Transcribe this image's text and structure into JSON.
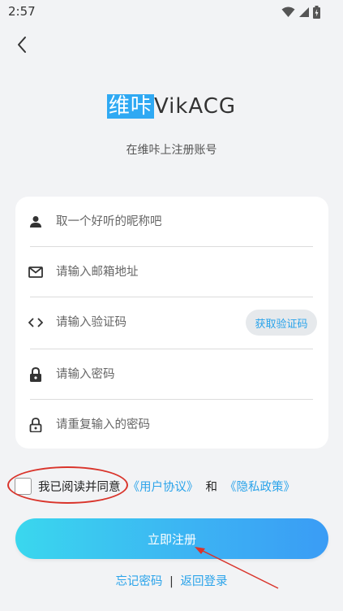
{
  "status_bar": {
    "time": "2:57"
  },
  "header": {
    "back_icon": "chevron-left-icon"
  },
  "brand": {
    "logo_cn": "维咔",
    "logo_en": "VikACG",
    "subtitle": "在维咔上注册账号"
  },
  "form": {
    "nickname": {
      "placeholder": "取一个好听的昵称吧",
      "value": "",
      "icon": "person-icon"
    },
    "email": {
      "placeholder": "请输入邮箱地址",
      "value": "",
      "icon": "mail-icon"
    },
    "code": {
      "placeholder": "请输入验证码",
      "value": "",
      "icon": "code-icon"
    },
    "get_code_label": "获取验证码",
    "password": {
      "placeholder": "请输入密码",
      "value": "",
      "icon": "lock-icon"
    },
    "password_confirm": {
      "placeholder": "请重复输入的密码",
      "value": "",
      "icon": "lock-outline-icon"
    }
  },
  "agreement": {
    "checked": false,
    "prefix": "我已阅读并同意",
    "user_agreement": "《用户协议》",
    "and": "和",
    "privacy_policy": "《隐私政策》"
  },
  "register_button": "立即注册",
  "footer": {
    "forgot_password": "忘记密码",
    "separator": "|",
    "back_to_login": "返回登录"
  },
  "colors": {
    "accent": "#2aa3ea",
    "background": "#f2f3f5",
    "annotation": "#d9342b"
  }
}
